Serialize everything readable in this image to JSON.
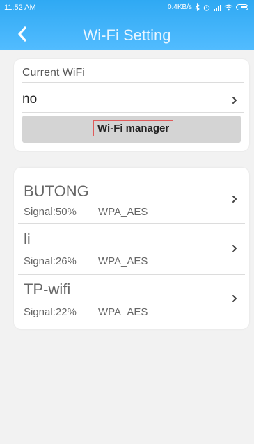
{
  "status_bar": {
    "time": "11:52 AM",
    "speed": "0.4KB/s",
    "icons": [
      "bluetooth-icon",
      "alarm-icon",
      "signal-icon",
      "wifi-icon",
      "battery-icon"
    ]
  },
  "header": {
    "title": "Wi-Fi Setting",
    "back_icon": "chevron-left-icon"
  },
  "current": {
    "label": "Current WiFi",
    "ssid": "no",
    "manager_button": "Wi-Fi manager"
  },
  "networks": [
    {
      "name": "BUTONG",
      "signal": "Signal:50%",
      "security": "WPA_AES"
    },
    {
      "name": "li",
      "signal": "Signal:26%",
      "security": "WPA_AES"
    },
    {
      "name": "TP-wifi",
      "signal": "Signal:22%",
      "security": "WPA_AES"
    }
  ],
  "colors": {
    "header_top": "#2fa9f3",
    "header_bottom": "#52bcff",
    "background": "#f2f2f2",
    "card": "#ffffff",
    "button": "#d4d4d4",
    "highlight_border": "#e05a5a"
  }
}
